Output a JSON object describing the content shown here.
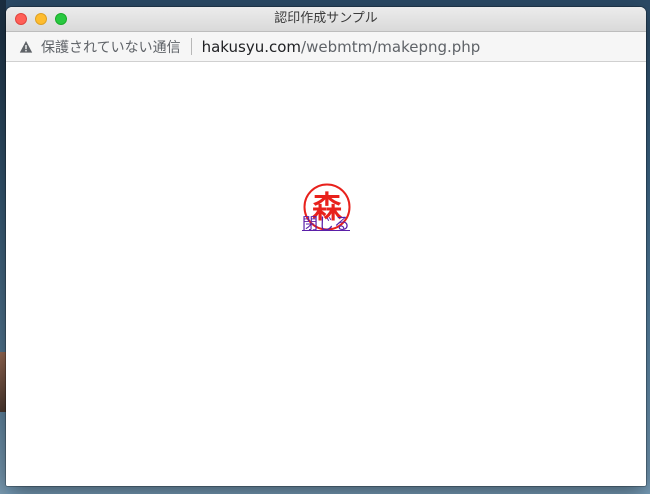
{
  "window": {
    "title": "認印作成サンプル"
  },
  "addressbar": {
    "security_text": "保護されていない通信",
    "url_host": "hakusyu.com",
    "url_path": "/webmtm/makepng.php"
  },
  "content": {
    "stamp_char": "森",
    "close_label": "閉じる"
  },
  "colors": {
    "stamp_red": "#e8211c",
    "link_visited": "#5a1fa8"
  },
  "icons": {
    "security": "warning-triangle-icon"
  }
}
